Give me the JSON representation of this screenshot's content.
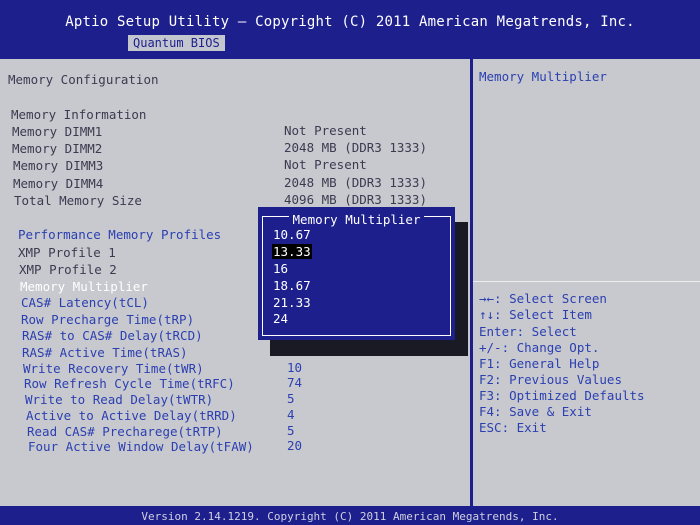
{
  "header": {
    "title": "Aptio Setup Utility – Copyright (C) 2011 American Megatrends, Inc.",
    "tab": "Quantum BIOS"
  },
  "left": {
    "section_title": "Memory Configuration",
    "info_title": "Memory Information",
    "info_rows": [
      {
        "label": "Memory DIMM1",
        "value": "Not Present"
      },
      {
        "label": "Memory DIMM2",
        "value": "2048 MB (DDR3 1333)"
      },
      {
        "label": "Memory DIMM3",
        "value": "Not Present"
      },
      {
        "label": "Memory DIMM4",
        "value": "2048 MB (DDR3 1333)"
      },
      {
        "label": "Total Memory Size",
        "value": "4096 MB (DDR3 1333)"
      }
    ],
    "perf_title": "Performance Memory Profiles",
    "xmp1": "XMP Profile 1",
    "xmp2": "XMP Profile 2",
    "multiplier_label": "Memory Multiplier",
    "timings": [
      {
        "label": "CAS# Latency(tCL)",
        "value": ""
      },
      {
        "label": "Row Precharge Time(tRP)",
        "value": ""
      },
      {
        "label": "RAS# to CAS# Delay(tRCD)",
        "value": ""
      },
      {
        "label": "RAS# Active Time(tRAS)",
        "value": ""
      },
      {
        "label": "Write Recovery Time(tWR)",
        "value": "10"
      },
      {
        "label": "Row Refresh Cycle Time(tRFC)",
        "value": "74"
      },
      {
        "label": "Write to Read Delay(tWTR)",
        "value": "5"
      },
      {
        "label": "Active to Active Delay(tRRD)",
        "value": "4"
      },
      {
        "label": "Read CAS# Precharege(tRTP)",
        "value": "5"
      },
      {
        "label": "Four Active Window Delay(tFAW)",
        "value": "20"
      }
    ]
  },
  "popup": {
    "title": "Memory Multiplier",
    "options": [
      "10.67",
      "13.33",
      "16",
      "18.67",
      "21.33",
      "24"
    ],
    "selected": "13.33"
  },
  "right": {
    "help_title": "Memory Multiplier",
    "keys": [
      "→←: Select Screen",
      "↑↓: Select Item",
      "Enter: Select",
      "+/-: Change Opt.",
      "F1: General Help",
      "F2: Previous Values",
      "F3: Optimized Defaults",
      "F4: Save & Exit",
      "ESC: Exit"
    ]
  },
  "footer": {
    "text": "Version 2.14.1219. Copyright (C) 2011 American Megatrends, Inc."
  }
}
